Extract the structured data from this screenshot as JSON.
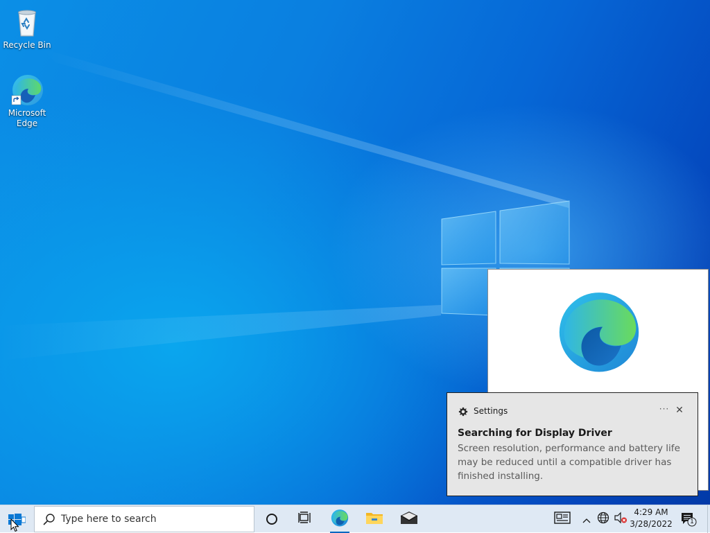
{
  "desktop": {
    "icons": [
      {
        "label": "Recycle Bin",
        "icon": "recycle-bin-icon"
      },
      {
        "label": "Microsoft\nEdge",
        "icon": "edge-icon"
      }
    ]
  },
  "splash": {
    "icon": "edge-logo-icon"
  },
  "toast": {
    "app_name": "Settings",
    "app_icon": "gear-icon",
    "title": "Searching for Display Driver",
    "body": "Screen resolution, performance and battery life may be reduced until a compatible driver has finished installing.",
    "more_label": "···",
    "close_label": "✕"
  },
  "taskbar": {
    "search_placeholder": "Type here to search",
    "pinned": [
      {
        "name": "cortana",
        "icon": "cortana-circle-icon"
      },
      {
        "name": "task-view",
        "icon": "task-view-icon"
      },
      {
        "name": "edge",
        "icon": "edge-icon",
        "active": true
      },
      {
        "name": "file-explorer",
        "icon": "folder-icon"
      },
      {
        "name": "mail",
        "icon": "mail-icon"
      }
    ],
    "tray": {
      "time": "4:29 AM",
      "date": "3/28/2022",
      "notification_count": "1"
    }
  },
  "colors": {
    "accent": "#0067c0",
    "taskbar_bg": "#dfe9f4",
    "toast_bg": "#e6e6e6"
  }
}
